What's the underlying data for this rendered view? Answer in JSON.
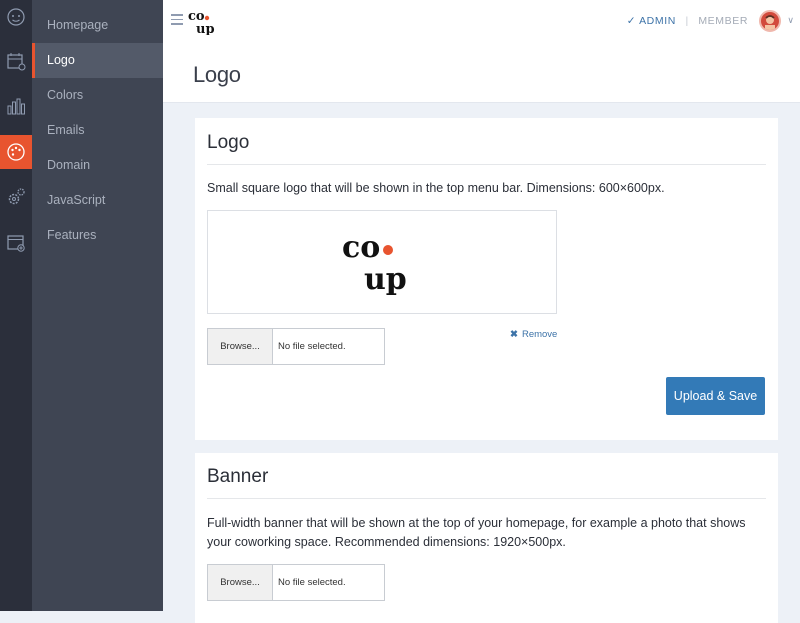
{
  "brand": {
    "line1": "co",
    "line2": "up",
    "accent": "#e8542f"
  },
  "rail": {
    "icons": [
      "face-icon",
      "calendar-icon",
      "bar-chart-icon",
      "palette-icon",
      "gears-icon",
      "window-add-icon"
    ],
    "active_index": 3,
    "accent": "#e8542f"
  },
  "sidebar": {
    "items": [
      {
        "label": "Homepage"
      },
      {
        "label": "Logo"
      },
      {
        "label": "Colors"
      },
      {
        "label": "Emails"
      },
      {
        "label": "Domain"
      },
      {
        "label": "JavaScript"
      },
      {
        "label": "Features"
      }
    ],
    "active_index": 1
  },
  "topbar": {
    "admin_label": "ADMIN",
    "member_label": "MEMBER",
    "check_icon": "check-icon",
    "caret_icon": "chevron-down-icon"
  },
  "page": {
    "title": "Logo"
  },
  "logo_section": {
    "heading": "Logo",
    "description": "Small square logo that will be shown in the top menu bar. Dimensions: 600×600px.",
    "browse_label": "Browse...",
    "file_status": "No file selected.",
    "remove_label": "Remove",
    "upload_label": "Upload & Save"
  },
  "banner_section": {
    "heading": "Banner",
    "description": "Full-width banner that will be shown at the top of your homepage, for example a photo that shows your coworking space. Recommended dimensions: 1920×500px.",
    "browse_label": "Browse...",
    "file_status": "No file selected."
  },
  "colors": {
    "primary_button": "#337ab7",
    "link": "#3d73a8"
  }
}
